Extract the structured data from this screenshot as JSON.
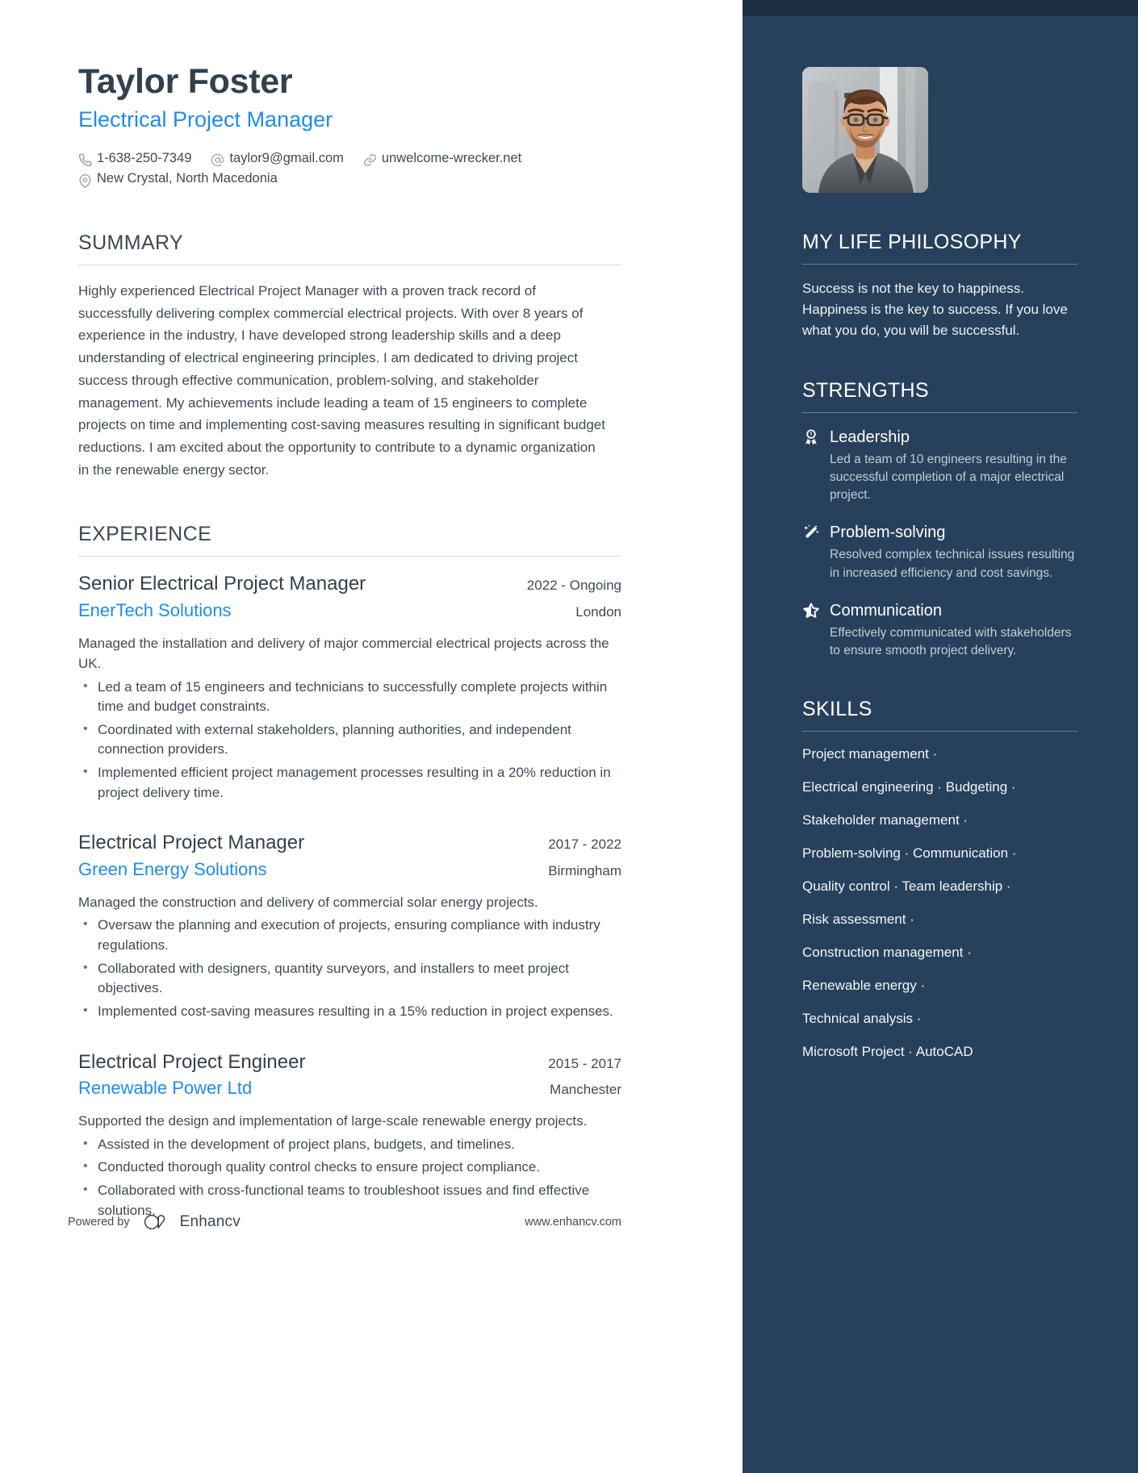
{
  "header": {
    "name": "Taylor Foster",
    "job_title": "Electrical Project Manager",
    "contacts": [
      {
        "icon": "phone-icon",
        "text": "1-638-250-7349"
      },
      {
        "icon": "email-icon",
        "text": "taylor9@gmail.com"
      },
      {
        "icon": "link-icon",
        "text": "unwelcome-wrecker.net"
      }
    ],
    "location": {
      "icon": "location-pin-icon",
      "text": "New Crystal, North Macedonia"
    }
  },
  "summary": {
    "heading": "SUMMARY",
    "text": "Highly experienced Electrical Project Manager with a proven track record of successfully delivering complex commercial electrical projects. With over 8 years of experience in the industry, I have developed strong leadership skills and a deep understanding of electrical engineering principles. I am dedicated to driving project success through effective communication, problem-solving, and stakeholder management. My achievements include leading a team of 15 engineers to complete projects on time and implementing cost-saving measures resulting in significant budget reductions. I am excited about the opportunity to contribute to a dynamic organization in the renewable energy sector."
  },
  "experience": {
    "heading": "EXPERIENCE",
    "items": [
      {
        "title": "Senior Electrical Project Manager",
        "date": "2022 - Ongoing",
        "company": "EnerTech Solutions",
        "location": "London",
        "description": "Managed the installation and delivery of major commercial electrical projects across the UK.",
        "bullets": [
          "Led a team of 15 engineers and technicians to successfully complete projects within time and budget constraints.",
          "Coordinated with external stakeholders, planning authorities, and independent connection providers.",
          "Implemented efficient project management processes resulting in a 20% reduction in project delivery time."
        ]
      },
      {
        "title": "Electrical Project Manager",
        "date": "2017 - 2022",
        "company": "Green Energy Solutions",
        "location": "Birmingham",
        "description": "Managed the construction and delivery of commercial solar energy projects.",
        "bullets": [
          "Oversaw the planning and execution of projects, ensuring compliance with industry regulations.",
          "Collaborated with designers, quantity surveyors, and installers to meet project objectives.",
          "Implemented cost-saving measures resulting in a 15% reduction in project expenses."
        ]
      },
      {
        "title": "Electrical Project Engineer",
        "date": "2015 - 2017",
        "company": "Renewable Power Ltd",
        "location": "Manchester",
        "description": "Supported the design and implementation of large-scale renewable energy projects.",
        "bullets": [
          "Assisted in the development of project plans, budgets, and timelines.",
          "Conducted thorough quality control checks to ensure project compliance.",
          "Collaborated with cross-functional teams to troubleshoot issues and find effective solutions."
        ]
      }
    ]
  },
  "footer": {
    "powered_by": "Powered by",
    "brand": "Enhancv",
    "url": "www.enhancv.com"
  },
  "sidebar": {
    "philosophy": {
      "heading": "MY LIFE PHILOSOPHY",
      "text": "Success is not the key to happiness. Happiness is the key to success. If you love what you do, you will be successful."
    },
    "strengths": {
      "heading": "STRENGTHS",
      "items": [
        {
          "icon": "award-ribbon-icon",
          "title": "Leadership",
          "description": "Led a team of 10 engineers resulting in the successful completion of a major electrical project."
        },
        {
          "icon": "magic-wand-icon",
          "title": "Problem-solving",
          "description": "Resolved complex technical issues resulting in increased efficiency and cost savings."
        },
        {
          "icon": "star-icon",
          "title": "Communication",
          "description": "Effectively communicated with stakeholders to ensure smooth project delivery."
        }
      ]
    },
    "skills": {
      "heading": "SKILLS",
      "lines": [
        "Project management ·",
        "Electrical engineering · Budgeting ·",
        "Stakeholder management ·",
        "Problem-solving · Communication ·",
        "Quality control · Team leadership ·",
        "Risk assessment ·",
        "Construction management ·",
        "Renewable energy ·",
        "Technical analysis ·",
        "Microsoft Project · AutoCAD"
      ]
    }
  },
  "colors": {
    "sidebar_bg": "#27415c",
    "sidebar_top_strip": "#1b2e44",
    "accent_blue": "#1f8ceb",
    "heading_text": "#3c4855",
    "body_text": "#3f4a57"
  }
}
